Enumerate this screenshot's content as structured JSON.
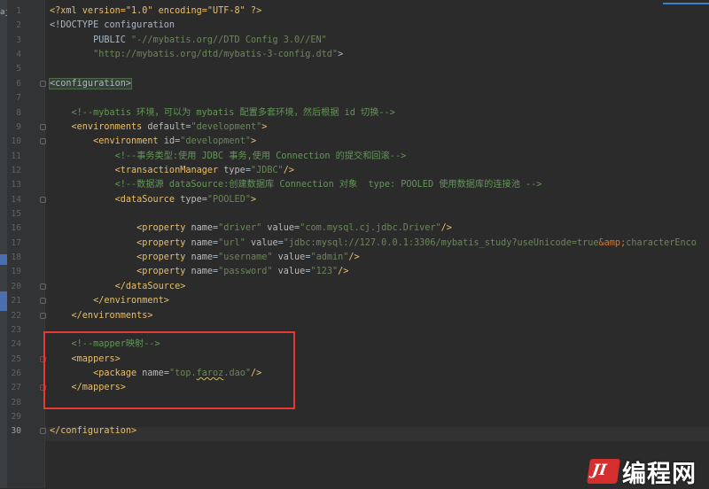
{
  "editor": {
    "sidebar_tab_char": "aj",
    "current_line": 30,
    "line_numbers": [
      "1",
      "2",
      "3",
      "4",
      "5",
      "6",
      "7",
      "8",
      "9",
      "10",
      "11",
      "12",
      "13",
      "14",
      "15",
      "16",
      "17",
      "18",
      "19",
      "20",
      "21",
      "22",
      "23",
      "24",
      "25",
      "26",
      "27",
      "28",
      "29",
      "30"
    ],
    "lines": [
      [
        [
          "pi",
          "<?xml version=\"1.0\" encoding=\"UTF-8\" ?>"
        ]
      ],
      [
        [
          "txt",
          "<!DOCTYPE configuration"
        ]
      ],
      [
        [
          "txt",
          "        PUBLIC "
        ],
        [
          "val",
          "\"-//mybatis.org//DTD Config 3.0//EN\""
        ]
      ],
      [
        [
          "val",
          "        \"http://mybatis.org/dtd/mybatis-3-config.dtd\""
        ],
        [
          "txt",
          ">"
        ]
      ],
      [],
      [
        [
          "hl",
          "<configuration>"
        ]
      ],
      [],
      [
        [
          "comment",
          "    <!--mybatis 环境，可以为 mybatis 配置多套环境，然后根据 id 切换-->"
        ]
      ],
      [
        [
          "tag",
          "    <environments "
        ],
        [
          "attr",
          "default"
        ],
        [
          "txt",
          "="
        ],
        [
          "val",
          "\"development\""
        ],
        [
          "tag",
          ">"
        ]
      ],
      [
        [
          "tag",
          "        <environment "
        ],
        [
          "attr",
          "id"
        ],
        [
          "txt",
          "="
        ],
        [
          "val",
          "\"development\""
        ],
        [
          "tag",
          ">"
        ]
      ],
      [
        [
          "comment",
          "            <!--事务类型:使用 JDBC 事务,使用 Connection 的提交和回滚-->"
        ]
      ],
      [
        [
          "tag",
          "            <transactionManager "
        ],
        [
          "attr",
          "type"
        ],
        [
          "txt",
          "="
        ],
        [
          "val",
          "\"JDBC\""
        ],
        [
          "tag",
          "/>"
        ]
      ],
      [
        [
          "comment",
          "            <!--数据源 dataSource:创建数据库 Connection 对象  type: POOLED 使用数据库的连接池 -->"
        ]
      ],
      [
        [
          "tag",
          "            <dataSource "
        ],
        [
          "attr",
          "type"
        ],
        [
          "txt",
          "="
        ],
        [
          "val",
          "\"POOLED\""
        ],
        [
          "tag",
          ">"
        ]
      ],
      [],
      [
        [
          "tag",
          "                <property "
        ],
        [
          "attr",
          "name"
        ],
        [
          "txt",
          "="
        ],
        [
          "val",
          "\"driver\""
        ],
        [
          "attr",
          " value"
        ],
        [
          "txt",
          "="
        ],
        [
          "val",
          "\"com.mysql.cj.jdbc.Driver\""
        ],
        [
          "tag",
          "/>"
        ]
      ],
      [
        [
          "tag",
          "                <property "
        ],
        [
          "attr",
          "name"
        ],
        [
          "txt",
          "="
        ],
        [
          "val",
          "\"url\""
        ],
        [
          "attr",
          " value"
        ],
        [
          "txt",
          "="
        ],
        [
          "val",
          "\"jdbc:mysql://127.0.0.1:3306/mybatis_study?useUnicode=true"
        ],
        [
          "ent",
          "&amp;"
        ],
        [
          "val",
          "characterEnco"
        ]
      ],
      [
        [
          "tag",
          "                <property "
        ],
        [
          "attr",
          "name"
        ],
        [
          "txt",
          "="
        ],
        [
          "val",
          "\"username\""
        ],
        [
          "attr",
          " value"
        ],
        [
          "txt",
          "="
        ],
        [
          "val",
          "\"admin\""
        ],
        [
          "tag",
          "/>"
        ]
      ],
      [
        [
          "tag",
          "                <property "
        ],
        [
          "attr",
          "name"
        ],
        [
          "txt",
          "="
        ],
        [
          "val",
          "\"password\""
        ],
        [
          "attr",
          " value"
        ],
        [
          "txt",
          "="
        ],
        [
          "val",
          "\"123\""
        ],
        [
          "tag",
          "/>"
        ]
      ],
      [
        [
          "tag",
          "            </dataSource>"
        ]
      ],
      [
        [
          "tag",
          "        </environment>"
        ]
      ],
      [
        [
          "tag",
          "    </environments>"
        ]
      ],
      [],
      [
        [
          "comment",
          "    <!--mapper映射-->"
        ]
      ],
      [
        [
          "tag",
          "    <mappers>"
        ]
      ],
      [
        [
          "tag",
          "        <package "
        ],
        [
          "attr",
          "name"
        ],
        [
          "txt",
          "="
        ],
        [
          "val",
          "\"top."
        ],
        [
          "valerr",
          "faroz"
        ],
        [
          "val",
          ".dao\""
        ],
        [
          "tag",
          "/>"
        ]
      ],
      [
        [
          "tag",
          "    </mappers>"
        ]
      ],
      [],
      [],
      [
        [
          "tag",
          "</configuration>"
        ]
      ]
    ]
  },
  "watermark": {
    "logo_text": "JI",
    "text": "编程网"
  },
  "colors": {
    "annotation_box": "#e53935",
    "tag": "#e8bf6a",
    "string": "#6a8759",
    "comment": "#629755"
  }
}
